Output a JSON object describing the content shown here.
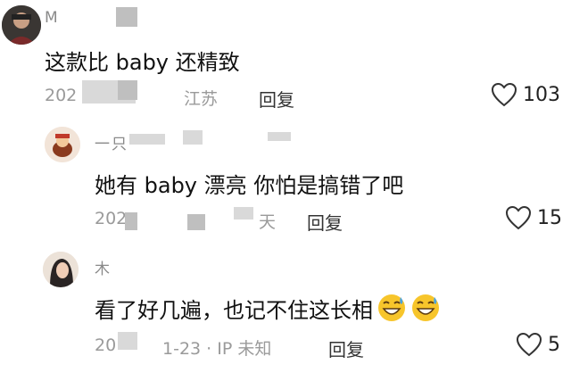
{
  "comments": [
    {
      "username": "M",
      "text": "这款比 baby 还精致",
      "date": "202",
      "location": "江苏",
      "reply_label": "回复",
      "likes": "103"
    },
    {
      "username": "一只",
      "text": "她有 baby 漂亮  你怕是搞错了吧",
      "date": "202",
      "location": "天",
      "reply_label": "回复",
      "likes": "15"
    },
    {
      "username": "木",
      "text": "看了好几遍，也记不住这长相",
      "date": "20",
      "location": "1-23 · IP 未知",
      "reply_label": "回复",
      "likes": "5",
      "emojis": [
        "sweat-smile-emoji",
        "sweat-smile-emoji"
      ]
    }
  ],
  "icons": {
    "like": "heart-outline-icon"
  },
  "colors": {
    "meta": "#9a9a9a",
    "text": "#111111",
    "emoji": "#f7c52b"
  }
}
